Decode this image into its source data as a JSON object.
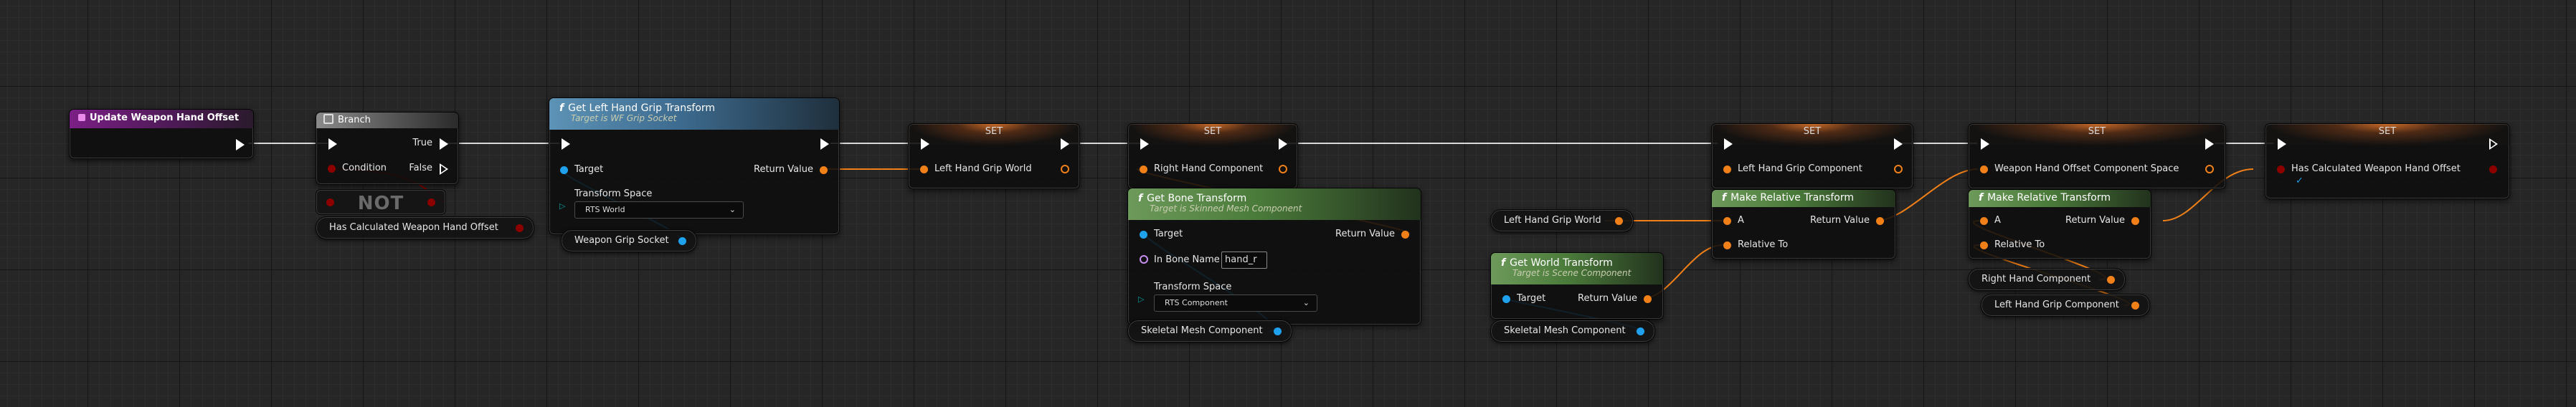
{
  "colors": {
    "exec": "#ffffff",
    "object_pin": "#1fa1ee",
    "transform_pin": "#f28018",
    "bool_pin": "#8c0000",
    "name_pin": "#c88ff0",
    "enum_pin": "#00666b",
    "event_header": "#7b1f86",
    "function_header": "#3d6b8f",
    "pure_header": "#4a7a3a"
  },
  "nodes": {
    "event": {
      "title": "Update Weapon Hand Offset"
    },
    "branch": {
      "title": "Branch",
      "true_label": "True",
      "condition_label": "Condition",
      "false_label": "False"
    },
    "not_node": {
      "label": "NOT"
    },
    "has_calc_var": {
      "label": "Has Calculated Weapon Hand Offset"
    },
    "get_grip": {
      "title": "Get Left Hand Grip Transform",
      "subtitle": "Target is WF Grip Socket",
      "target_label": "Target",
      "return_label": "Return Value",
      "space_label": "Transform Space",
      "space_value": "RTS World"
    },
    "weapon_grip_var": {
      "label": "Weapon Grip Socket"
    },
    "set1": {
      "title": "SET",
      "pin_label": "Left Hand Grip World"
    },
    "set2": {
      "title": "SET",
      "pin_label": "Right Hand Component"
    },
    "get_bone": {
      "title": "Get Bone Transform",
      "subtitle": "Target is Skinned Mesh Component",
      "target_label": "Target",
      "return_label": "Return Value",
      "bone_label": "In Bone Name",
      "bone_value": "hand_r",
      "space_label": "Transform Space",
      "space_value": "RTS Component"
    },
    "skel_var1": {
      "label": "Skeletal Mesh Component"
    },
    "left_world_var": {
      "label": "Left Hand Grip World"
    },
    "get_world": {
      "title": "Get World Transform",
      "subtitle": "Target is Scene Component",
      "target_label": "Target",
      "return_label": "Return Value"
    },
    "skel_var2": {
      "label": "Skeletal Mesh Component"
    },
    "set3": {
      "title": "SET",
      "pin_label": "Left Hand Grip Component"
    },
    "make_rel1": {
      "title": "Make Relative Transform",
      "a_label": "A",
      "return_label": "Return Value",
      "rel_label": "Relative To"
    },
    "set4": {
      "title": "SET",
      "pin_label": "Weapon Hand Offset Component Space"
    },
    "make_rel2": {
      "title": "Make Relative Transform",
      "a_label": "A",
      "return_label": "Return Value",
      "rel_label": "Relative To"
    },
    "right_hand_var": {
      "label": "Right Hand Component"
    },
    "left_grip_var": {
      "label": "Left Hand Grip Component"
    },
    "set5": {
      "title": "SET",
      "pin_label": "Has Calculated Weapon Hand Offset"
    }
  }
}
